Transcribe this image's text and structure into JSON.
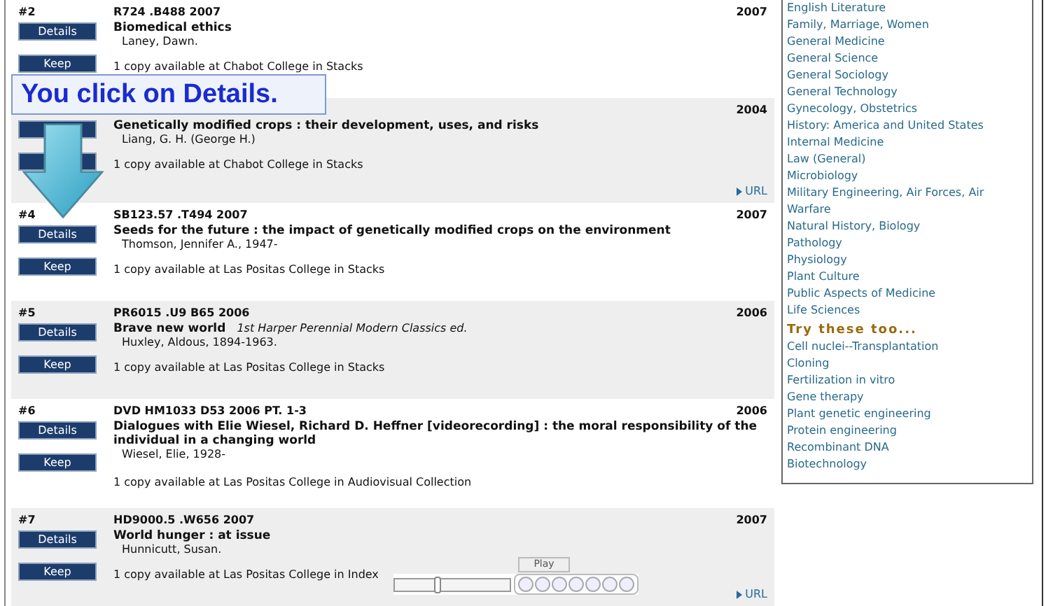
{
  "records": [
    {
      "number": "#2",
      "call_number": "R724 .B488 2007",
      "year": "2007",
      "title": "Biomedical ethics",
      "author": "Laney, Dawn.",
      "availability": "1 copy available at Chabot College in Stacks",
      "details": "Details",
      "keep": "Keep"
    },
    {
      "year": "2004",
      "title": "Genetically modified crops : their development, uses, and risks",
      "author": "Liang, G. H. (George H.)",
      "availability": "1 copy available at Chabot College in Stacks",
      "url": "URL"
    },
    {
      "number": "#4",
      "call_number": "SB123.57 .T494 2007",
      "year": "2007",
      "title": "Seeds for the future : the impact of genetically modified crops on the environment",
      "author": "Thomson, Jennifer A., 1947-",
      "availability": "1 copy available at Las Positas College in Stacks",
      "details": "Details",
      "keep": "Keep"
    },
    {
      "number": "#5",
      "call_number": "PR6015 .U9 B65 2006",
      "year": "2006",
      "title": "Brave new world",
      "edition": "1st Harper Perennial Modern Classics ed.",
      "author": "Huxley, Aldous, 1894-1963.",
      "availability": "1 copy available at Las Positas College in Stacks",
      "details": "Details",
      "keep": "Keep"
    },
    {
      "number": "#6",
      "call_number": "DVD HM1033 D53 2006 PT. 1-3",
      "year": "2006",
      "title": "Dialogues with Elie Wiesel, Richard D. Heffner [videorecording] : the moral responsibility of the individual in a changing world",
      "author": "Wiesel, Elie, 1928-",
      "availability": "1 copy available at Las Positas College in Audiovisual Collection",
      "details": "Details",
      "keep": "Keep"
    },
    {
      "number": "#7",
      "call_number": "HD9000.5 .W656 2007",
      "year": "2007",
      "title": "World hunger : at issue",
      "author": "Hunnicutt, Susan.",
      "availability": "1 copy available at Las Positas College in Index",
      "details": "Details",
      "keep": "Keep",
      "url": "URL"
    }
  ],
  "sidebar": {
    "subjects": [
      "English Literature",
      "Family, Marriage, Women",
      "General Medicine",
      "General Science",
      "General Sociology",
      "General Technology",
      "Gynecology, Obstetrics",
      "History: America and United States",
      "Internal Medicine",
      "Law (General)",
      "Microbiology",
      "Military Engineering, Air Forces, Air Warfare",
      "Natural History, Biology",
      "Pathology",
      "Physiology",
      "Plant Culture",
      "Public Aspects of Medicine",
      "Life Sciences"
    ],
    "related_heading": "Try these too...",
    "related": [
      "Cell nuclei--Transplantation",
      "Cloning",
      "Fertilization in vitro",
      "Gene therapy",
      "Plant genetic engineering",
      "Protein engineering",
      "Recombinant DNA",
      "Biotechnology"
    ]
  },
  "callout": {
    "text": "You click on Details."
  },
  "player": {
    "tooltip": "Play",
    "level": 0.35
  }
}
